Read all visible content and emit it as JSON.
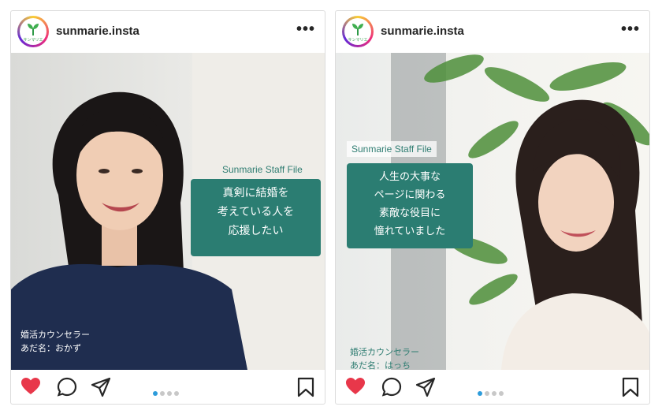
{
  "posts": [
    {
      "username": "sunmarie.insta",
      "avatar_text": "サンマリエ",
      "more_label": "•••",
      "staff_file": "Sunmarie Staff File",
      "caption_lines": [
        "真剣に結婚を",
        "考えている人を",
        "応援したい"
      ],
      "role_lines": [
        "婚活カウンセラー",
        "あだ名：おかず"
      ],
      "carousel": {
        "count": 4,
        "active": 1
      }
    },
    {
      "username": "sunmarie.insta",
      "avatar_text": "サンマリエ",
      "more_label": "•••",
      "staff_file": "Sunmarie Staff File",
      "caption_lines": [
        "人生の大事な",
        "ページに関わる",
        "素敵な役目に",
        "憧れていました"
      ],
      "role_lines": [
        "婚活カウンセラー",
        "あだ名：はっち"
      ],
      "carousel": {
        "count": 4,
        "active": 1
      }
    }
  ],
  "icons": {
    "like": "heart-icon",
    "comment": "comment-icon",
    "share": "share-icon",
    "save": "bookmark-icon"
  },
  "colors": {
    "like": "#e8374a",
    "caption_block": "#2b7d72",
    "carousel_active": "#2d9cdb"
  }
}
